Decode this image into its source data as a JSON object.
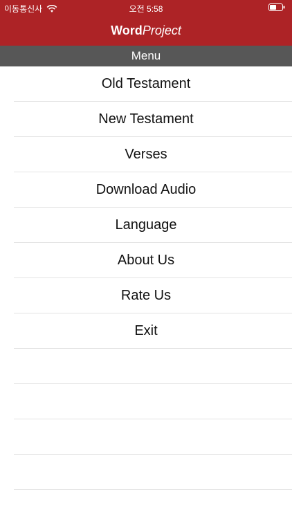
{
  "status_bar": {
    "carrier": "이동통신사",
    "time": "오전 5:58"
  },
  "nav": {
    "title_bold": "Word",
    "title_italic": "Project"
  },
  "menu_header": "Menu",
  "menu_items": [
    "Old Testament",
    "New Testament",
    "Verses",
    "Download Audio",
    "Language",
    "About Us",
    "Rate Us",
    "Exit"
  ],
  "colors": {
    "brand": "#ad2326",
    "header_gray": "#575757"
  }
}
